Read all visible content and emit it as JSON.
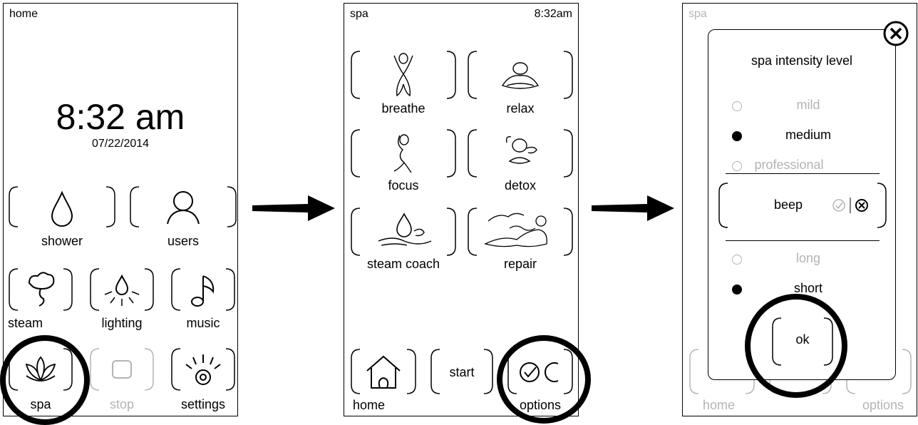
{
  "screen1": {
    "title": "home",
    "time": "8:32 am",
    "date": "07/22/2014",
    "tiles": [
      {
        "label": "shower",
        "icon": "water-drop-icon",
        "enabled": true
      },
      {
        "label": "users",
        "icon": "user-icon",
        "enabled": true
      },
      {
        "label": "steam",
        "icon": "steam-icon",
        "enabled": true
      },
      {
        "label": "lighting",
        "icon": "light-bulb-icon",
        "enabled": true
      },
      {
        "label": "music",
        "icon": "music-note-icon",
        "enabled": true
      },
      {
        "label": "spa",
        "icon": "lotus-icon",
        "enabled": true
      },
      {
        "label": "stop",
        "icon": "stop-icon",
        "enabled": false
      },
      {
        "label": "settings",
        "icon": "settings-icon",
        "enabled": true
      }
    ]
  },
  "screen2": {
    "title": "spa",
    "time": "8:32am",
    "tiles": [
      {
        "label": "breathe",
        "icon": "breathe-figure-icon"
      },
      {
        "label": "relax",
        "icon": "relax-figure-icon"
      },
      {
        "label": "focus",
        "icon": "focus-figure-icon"
      },
      {
        "label": "detox",
        "icon": "detox-figure-icon"
      },
      {
        "label": "steam coach",
        "icon": "steam-coach-icon"
      },
      {
        "label": "repair",
        "icon": "repair-figure-icon"
      }
    ],
    "bottom": {
      "home": "home",
      "start": "start",
      "options": "options"
    }
  },
  "screen3": {
    "title": "spa",
    "dialog": {
      "title": "spa intensity level",
      "intensity": [
        {
          "label": "mild",
          "selected": false
        },
        {
          "label": "medium",
          "selected": true
        },
        {
          "label": "professional",
          "selected": false
        }
      ],
      "beep_label": "beep",
      "duration": [
        {
          "label": "long",
          "selected": false
        },
        {
          "label": "short",
          "selected": true
        }
      ],
      "ok_label": "ok"
    },
    "behind": {
      "home": "home",
      "options": "options"
    }
  },
  "colors": {
    "line": "#000000",
    "disabled": "#b4b4b4"
  }
}
